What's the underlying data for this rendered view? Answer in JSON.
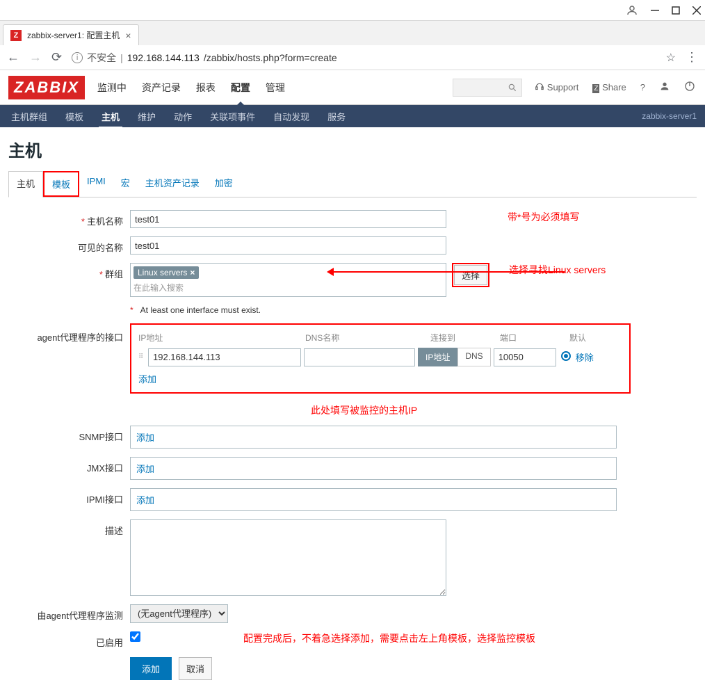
{
  "browser": {
    "tab_title": "zabbix-server1: 配置主机",
    "insecure_label": "不安全",
    "url_host": "192.168.144.113",
    "url_path": "/zabbix/hosts.php?form=create"
  },
  "header": {
    "logo": "ZABBIX",
    "nav": [
      "监测中",
      "资产记录",
      "报表",
      "配置",
      "管理"
    ],
    "active_nav": "配置",
    "support": "Support",
    "share": "Share"
  },
  "subnav": {
    "items": [
      "主机群组",
      "模板",
      "主机",
      "维护",
      "动作",
      "关联项事件",
      "自动发现",
      "服务"
    ],
    "active": "主机",
    "server": "zabbix-server1"
  },
  "page": {
    "title": "主机",
    "tabs": [
      "主机",
      "模板",
      "IPMI",
      "宏",
      "主机资产记录",
      "加密"
    ],
    "active_tab": "主机",
    "highlight_tab": "模板"
  },
  "form": {
    "hostname_label": "主机名称",
    "hostname_value": "test01",
    "visiblename_label": "可见的名称",
    "visiblename_value": "test01",
    "groups_label": "群组",
    "group_tag": "Linux servers",
    "group_placeholder": "在此输入搜索",
    "select_btn": "选择",
    "iface_note": "At least one interface must exist.",
    "agent_label": "agent代理程序的接口",
    "cols": {
      "ip": "IP地址",
      "dns": "DNS名称",
      "connect": "连接到",
      "port": "端口",
      "default": "默认"
    },
    "ip_value": "192.168.144.113",
    "connect_ip": "IP地址",
    "connect_dns": "DNS",
    "port_value": "10050",
    "remove": "移除",
    "add": "添加",
    "snmp_label": "SNMP接口",
    "jmx_label": "JMX接口",
    "ipmi_label": "IPMI接口",
    "desc_label": "描述",
    "proxy_label": "由agent代理程序监测",
    "proxy_value": "(无agent代理程序)",
    "enabled_label": "已启用",
    "submit": "添加",
    "cancel": "取消"
  },
  "annotations": {
    "required_note": "带*号为必须填写",
    "group_note": "选择寻找Linux servers",
    "ip_note": "此处填写被监控的主机IP",
    "final_note": "配置完成后，不着急选择添加，需要点击左上角模板，选择监控模板"
  }
}
